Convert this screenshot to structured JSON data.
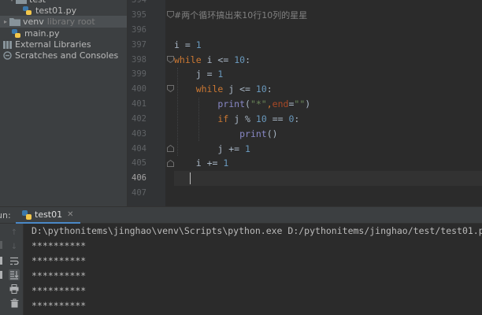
{
  "project_tree": {
    "items": [
      {
        "label": "test"
      },
      {
        "label": "test01.py"
      },
      {
        "label": "venv",
        "hint": "library root"
      },
      {
        "label": "main.py"
      },
      {
        "label": "External Libraries"
      },
      {
        "label": "Scratches and Consoles"
      }
    ]
  },
  "editor": {
    "line_numbers": [
      "394",
      "395",
      "396",
      "397",
      "398",
      "399",
      "400",
      "401",
      "402",
      "403",
      "404",
      "405",
      "406",
      "407"
    ],
    "comment": "#两个循环搞出来10行10列的星星",
    "tokens": {
      "i": "i",
      "j": "j",
      "assign": " = ",
      "one": "1",
      "ten": "10",
      "while": "while",
      "le": " <= ",
      "colon": ":",
      "print": "print",
      "lparen": "(",
      "rparen": ")",
      "star_str": "\"*\"",
      "comma": ",",
      "end_kw": "end",
      "eq": "=",
      "empty_str": "\"\"",
      "if": "if",
      "mod": " % ",
      "eqeq": " == ",
      "zero": "0",
      "plus_eq": " += ",
      "empty_call": "()"
    }
  },
  "run_panel": {
    "label": "un:",
    "tab_label": "test01",
    "command": "D:\\pythonitems\\jinghao\\venv\\Scripts\\python.exe D:/pythonitems/jinghao/test/test01.py",
    "output_lines": [
      "**********",
      "**********",
      "**********",
      "**********",
      "**********"
    ]
  },
  "colors": {
    "keyword": "#cc7832",
    "number": "#6897bb",
    "string": "#6a8759",
    "builtin": "#8888c6",
    "kwarg": "#aa4926",
    "comment": "#808080",
    "folder": "#87939a",
    "python_blue": "#3c78aa",
    "python_yellow": "#f3c74b"
  }
}
